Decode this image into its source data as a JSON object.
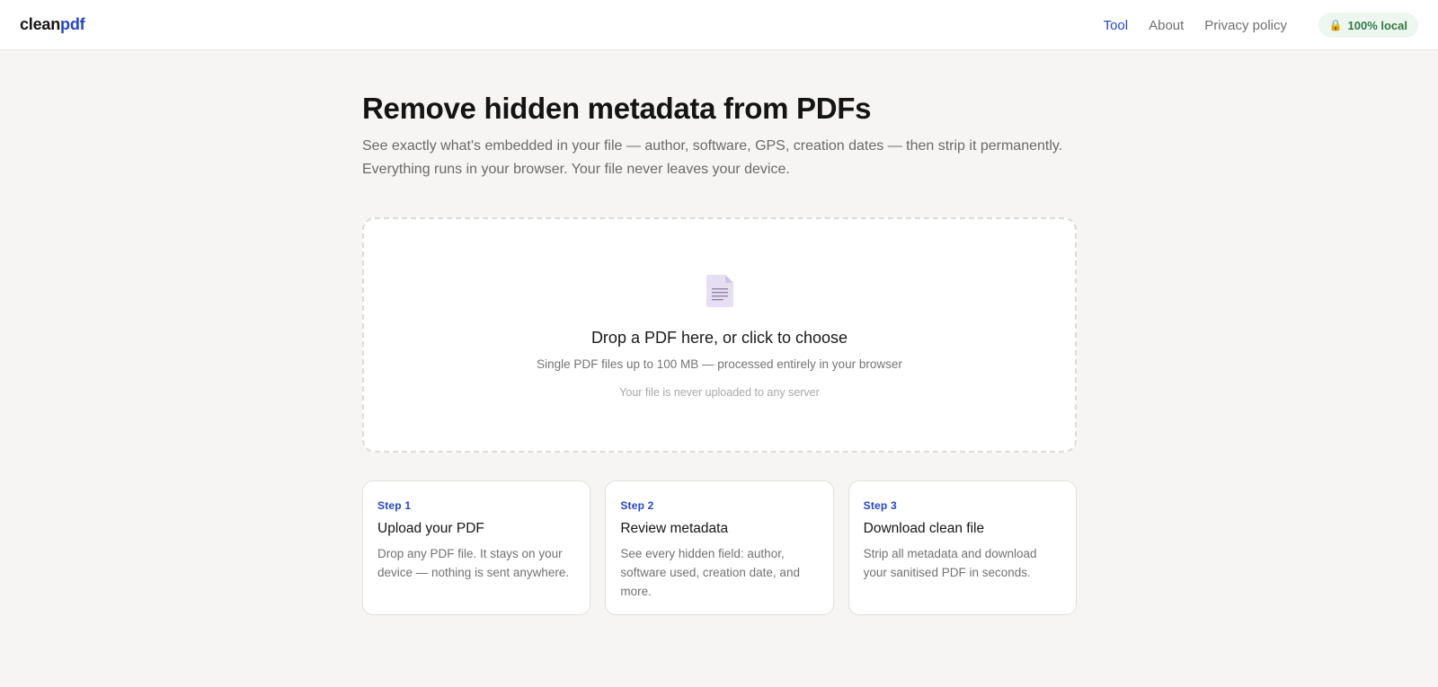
{
  "brand": {
    "part1": "clean",
    "part2": "pdf"
  },
  "nav": {
    "items": [
      {
        "label": "Tool",
        "active": true
      },
      {
        "label": "About",
        "active": false
      },
      {
        "label": "Privacy policy",
        "active": false
      }
    ],
    "badge": {
      "icon": "lock-icon",
      "glyph": "🔒",
      "label": "100% local"
    }
  },
  "hero": {
    "title": "Remove hidden metadata from PDFs",
    "subtitle": "See exactly what's embedded in your file — author, software, GPS, creation dates — then strip it permanently. Everything runs in your browser. Your file never leaves your device."
  },
  "dropzone": {
    "icon": "pdf-file-icon",
    "title": "Drop a PDF here, or click to choose",
    "subtitle": "Single PDF files up to 100 MB — processed entirely in your browser",
    "note": "Your file is never uploaded to any server"
  },
  "steps": [
    {
      "tag": "Step 1",
      "title": "Upload your PDF",
      "desc": "Drop any PDF file. It stays on your device — nothing is sent anywhere."
    },
    {
      "tag": "Step 2",
      "title": "Review metadata",
      "desc": "See every hidden field: author, software used, creation date, and more."
    },
    {
      "tag": "Step 3",
      "title": "Download clean file",
      "desc": "Strip all metadata and download your sanitised PDF in seconds."
    }
  ],
  "colors": {
    "accent": "#2447c9",
    "background": "#f6f5f3",
    "badge_text": "#2f7a47",
    "badge_bg": "#eef6f0"
  }
}
